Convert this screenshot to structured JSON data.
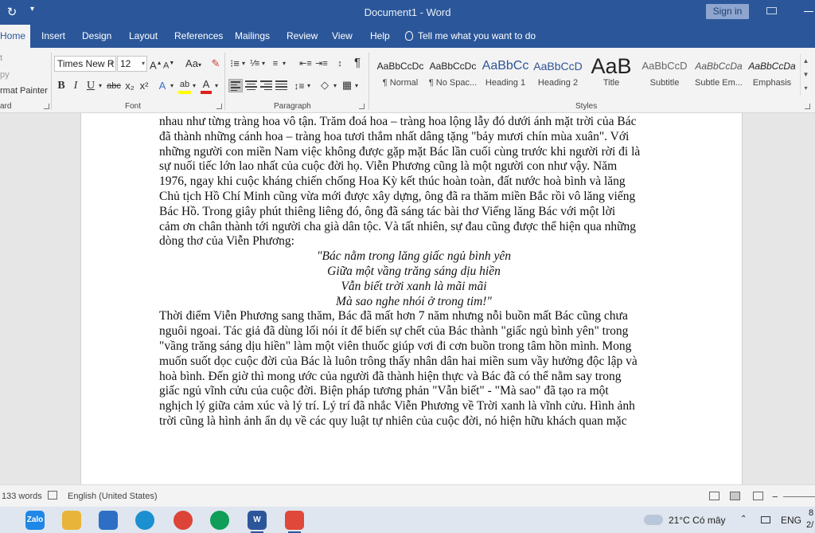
{
  "titlebar": {
    "title": "Document1  -  Word",
    "sign_in": "Sign in",
    "undo_icon": "redo-icon",
    "qat_icon": "customize-qat-icon"
  },
  "tabs": [
    "Home",
    "Insert",
    "Design",
    "Layout",
    "References",
    "Mailings",
    "Review",
    "View",
    "Help"
  ],
  "tell_me": "Tell me what you want to do",
  "clipboard": {
    "cut": "t",
    "copy": "py",
    "format_painter": "rmat Painter",
    "label": "ard"
  },
  "font": {
    "name": "Times New R",
    "size": "12",
    "label": "Font",
    "bold": "B",
    "italic": "I",
    "underline": "U",
    "strike": "abc",
    "subscript": "x₂",
    "superscript": "x²",
    "grow": "A",
    "shrink": "A",
    "change_case": "Aa",
    "text_effects": "A",
    "highlight": "ab",
    "font_color": "A",
    "font_color_bar": "#e0201a",
    "highlight_bar": "#ffff00"
  },
  "paragraph": {
    "label": "Paragraph",
    "pilcrow": "¶"
  },
  "styles": {
    "label": "Styles",
    "items": [
      {
        "sample": "AaBbCcDc",
        "name": "¶ Normal"
      },
      {
        "sample": "AaBbCcDc",
        "name": "¶ No Spac..."
      },
      {
        "sample": "AaBbCc",
        "name": "Heading 1"
      },
      {
        "sample": "AaBbCcD",
        "name": "Heading 2"
      },
      {
        "sample": "AaB",
        "name": "Title"
      },
      {
        "sample": "AaBbCcD",
        "name": "Subtitle"
      },
      {
        "sample": "AaBbCcDa",
        "name": "Subtle Em..."
      },
      {
        "sample": "AaBbCcDa",
        "name": "Emphasis"
      }
    ]
  },
  "document": {
    "paragraph1": [
      "nhau như từng tràng hoa vô tận. Trăm đoá hoa – tràng hoa lộng lẫy đó dưới ánh mặt trời của Bác",
      "đã thành những cánh hoa – tràng hoa tươi thắm nhất dâng tặng \"bảy mươi chín mùa xuân\". Với",
      "những người con miền Nam việc không được gặp mặt Bác lần cuối cùng trước khi người rời đi là",
      "sự nuối tiếc lớn lao nhất của cuộc đời họ. Viễn Phương cũng là một người con như vậy. Năm",
      "1976, ngay khi cuộc kháng chiến chống Hoa Kỳ kết thúc hoàn toàn, đất nước hoà bình và lăng",
      "Chủ tịch Hồ Chí Minh cũng vừa mới được xây dựng, ông đã ra thăm miền Bắc rồi vô lăng viếng",
      "Bác Hồ. Trong giây phút thiêng liêng đó, ông đã sáng tác bài thơ Viếng lăng Bác với một lời",
      "cảm ơn chân thành tới người cha già dân tộc. Và tất nhiên, sự đau cũng được thể hiện qua những",
      "dòng thơ của Viễn Phương:"
    ],
    "poem": [
      "\"Bác nằm trong lăng giấc ngủ bình yên",
      "Giữa một vầng trăng sáng dịu hiền",
      "Vẫn biết trời xanh là mãi mãi",
      "Mà sao nghe nhói ở trong tim!\""
    ],
    "paragraph2": [
      "Thời điểm Viễn Phương sang thăm, Bác đã mất hơn 7 năm nhưng nỗi buồn mất Bác cũng chưa",
      "nguôi ngoai. Tác giả đã dùng lối nói ít để biến sự chết của Bác thành \"giấc ngủ bình yên\" trong",
      "\"vầng trăng sáng dịu hiền\" làm một viên thuốc giúp vơi đi cơn buồn trong tâm hồn mình. Mong",
      "muốn suốt dọc cuộc đời của Bác là luôn trông thấy nhân dân hai miền sum vầy hưởng độc lập và",
      "hoà bình. Đến giờ thì mong ước của người đã thành hiện thực và Bác đã có thể nằm say trong",
      "giấc ngủ vĩnh cửu của cuộc đời. Biện pháp tương phản \"Vẫn biết\" - \"Mà sao\" đã tạo ra một",
      "nghịch lý giữa cảm xúc và lý trí. Lý trí đã nhắc Viễn Phương về Trời xanh là vĩnh cửu. Hình ảnh",
      "trời cũng là hình ảnh ẩn dụ về các quy luật tự nhiên của cuộc đời, nó hiện hữu khách quan mặc"
    ]
  },
  "statusbar": {
    "words": "133 words",
    "language": "English (United States)"
  },
  "taskbar": {
    "apps": [
      {
        "icon": "zalo-icon",
        "label": "Zalo",
        "color": "#1f87e6"
      },
      {
        "icon": "file-explorer-icon",
        "label": "",
        "color": "#e8b53a"
      },
      {
        "icon": "microsoft-store-icon",
        "label": "",
        "color": "#2d6fc4"
      },
      {
        "icon": "edge-icon",
        "label": "",
        "color": "#1b8fcf"
      },
      {
        "icon": "chrome-icon",
        "label": "",
        "color": "#db4437"
      },
      {
        "icon": "chrome-profile-icon",
        "label": "",
        "color": "#0f9d58"
      },
      {
        "icon": "word-icon",
        "label": "W",
        "color": "#2b579a"
      },
      {
        "icon": "snipping-tool-icon",
        "label": "",
        "color": "#e0483a"
      }
    ],
    "weather": "21°C  Có mây",
    "lang": "ENG",
    "clock_top": "8",
    "clock_bottom": "2/"
  }
}
